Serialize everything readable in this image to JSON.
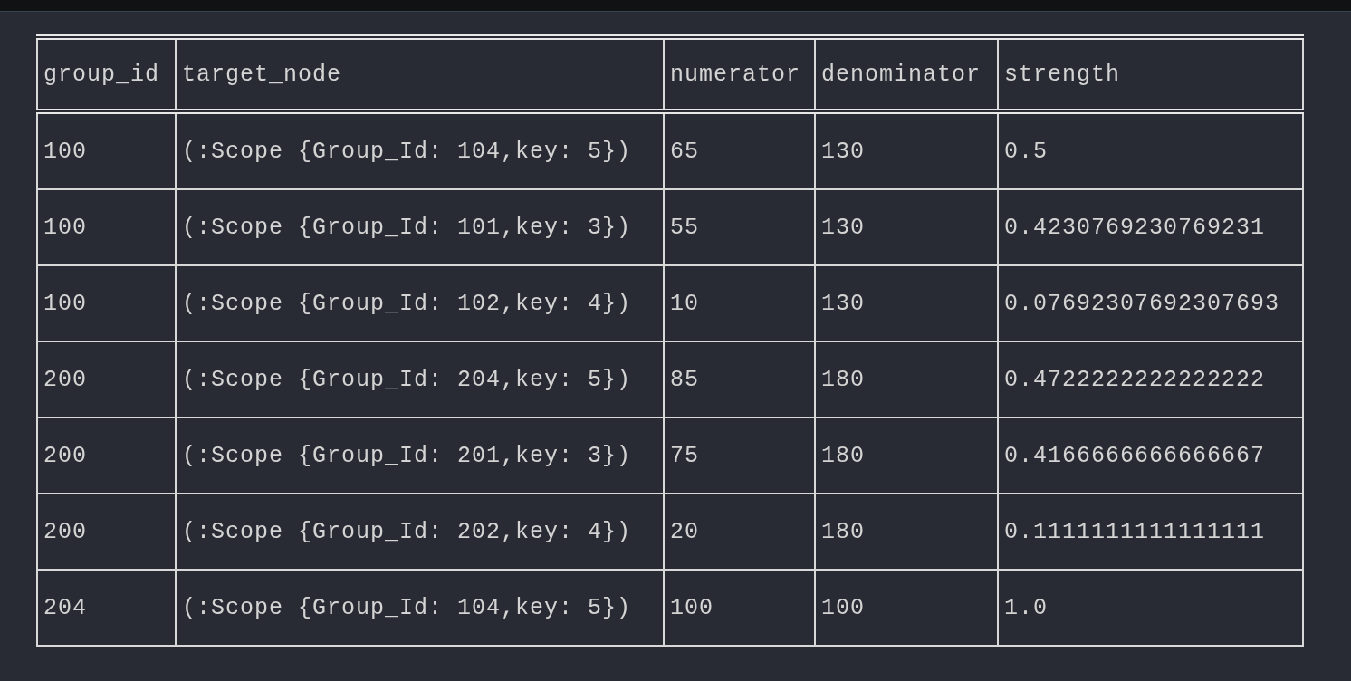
{
  "table": {
    "columns": [
      "group_id",
      "target_node",
      "numerator",
      "denominator",
      "strength"
    ],
    "rows": [
      [
        "100",
        "(:Scope {Group_Id: 104,key: 5})",
        "65",
        "130",
        "0.5"
      ],
      [
        "100",
        "(:Scope {Group_Id: 101,key: 3})",
        "55",
        "130",
        "0.4230769230769231"
      ],
      [
        "100",
        "(:Scope {Group_Id: 102,key: 4})",
        "10",
        "130",
        "0.07692307692307693"
      ],
      [
        "200",
        "(:Scope {Group_Id: 204,key: 5})",
        "85",
        "180",
        "0.4722222222222222"
      ],
      [
        "200",
        "(:Scope {Group_Id: 201,key: 3})",
        "75",
        "180",
        "0.4166666666666667"
      ],
      [
        "200",
        "(:Scope {Group_Id: 202,key: 4})",
        "20",
        "180",
        "0.1111111111111111"
      ],
      [
        "204",
        "(:Scope {Group_Id: 104,key: 5})",
        "100",
        "100",
        "1.0"
      ]
    ]
  }
}
